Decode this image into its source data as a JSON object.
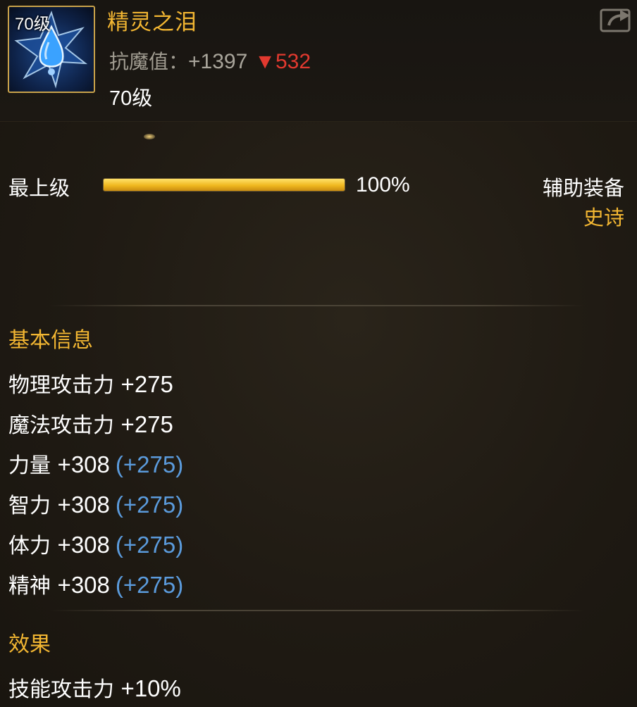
{
  "item": {
    "name": "精灵之泪",
    "icon_level": "70级",
    "icon": "teardrop-gem-icon",
    "stat_label": "抗魔值：",
    "stat_value": "+1397",
    "stat_diff": "▼532",
    "level": "70级"
  },
  "grade": {
    "label": "最上级",
    "percent_text": "100%",
    "progress": 1.0
  },
  "equip": {
    "type": "辅助装备",
    "rarity": "史诗"
  },
  "basic_info": {
    "title": "基本信息",
    "attributes": [
      {
        "name": "物理攻击力",
        "value": "+275",
        "bonus": ""
      },
      {
        "name": "魔法攻击力",
        "value": "+275",
        "bonus": ""
      },
      {
        "name": "力量",
        "value": "+308",
        "bonus": "(+275)"
      },
      {
        "name": "智力",
        "value": "+308",
        "bonus": "(+275)"
      },
      {
        "name": "体力",
        "value": "+308",
        "bonus": "(+275)"
      },
      {
        "name": "精神",
        "value": "+308",
        "bonus": "(+275)"
      }
    ]
  },
  "effects": {
    "title": "效果",
    "items": [
      {
        "name": "技能攻击力",
        "value": "+10%"
      }
    ]
  },
  "colors": {
    "gold": "#f2b632",
    "bonus_blue": "#5b9bdc",
    "down_red": "#e2392f"
  },
  "share_icon": "share-icon"
}
